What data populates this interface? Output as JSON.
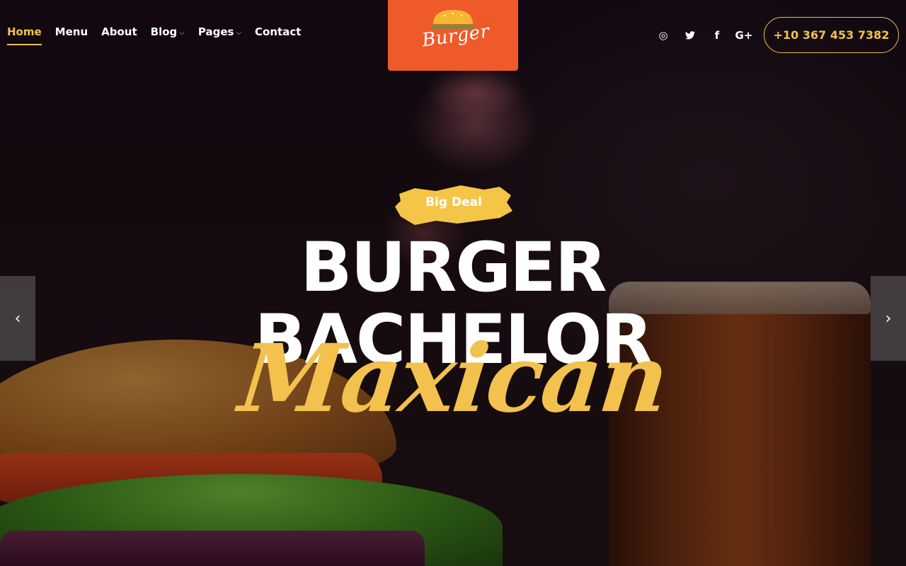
{
  "nav": {
    "items": [
      {
        "label": "Home",
        "active": true,
        "dropdown": false
      },
      {
        "label": "Menu",
        "active": false,
        "dropdown": false
      },
      {
        "label": "About",
        "active": false,
        "dropdown": false
      },
      {
        "label": "Blog",
        "active": false,
        "dropdown": true
      },
      {
        "label": "Pages",
        "active": false,
        "dropdown": true
      },
      {
        "label": "Contact",
        "active": false,
        "dropdown": false
      }
    ],
    "active_color": "#f2c14e"
  },
  "logo": {
    "text": "Burger",
    "background": "#ef5a2a"
  },
  "socials": [
    {
      "icon": "instagram-icon",
      "glyph": "◎"
    },
    {
      "icon": "twitter-icon",
      "glyph": "🐦"
    },
    {
      "icon": "facebook-icon",
      "glyph": "f"
    },
    {
      "icon": "google-plus-icon",
      "glyph": "G+"
    }
  ],
  "phone": "+10 367 453 7382",
  "hero": {
    "badge": "Big Deal",
    "title_line_1": "BURGER",
    "title_line_2": "BACHELOR",
    "script": "Maxican",
    "accent_color": "#f2c14e"
  },
  "slider": {
    "prev_icon": "chevron-left-icon",
    "prev_glyph": "‹",
    "next_icon": "chevron-right-icon",
    "next_glyph": "›"
  }
}
